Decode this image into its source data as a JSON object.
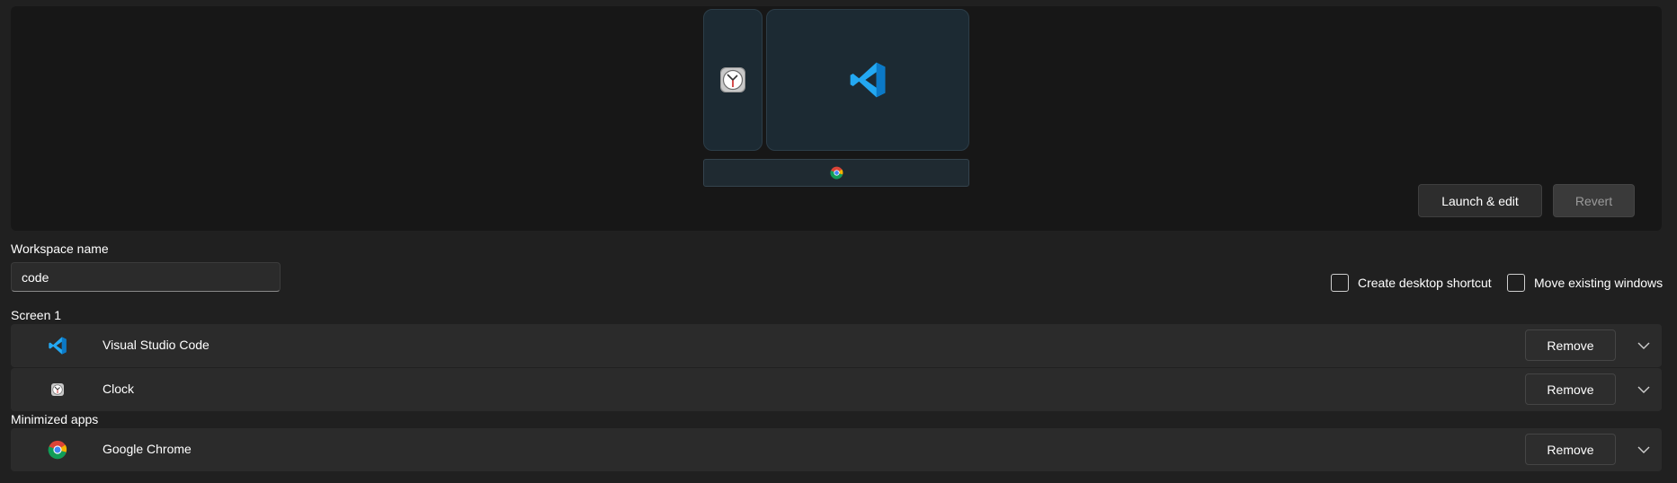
{
  "preview": {
    "launch_label": "Launch & edit",
    "revert_label": "Revert"
  },
  "workspace": {
    "name_label": "Workspace name",
    "name_value": "code",
    "create_shortcut_label": "Create desktop shortcut",
    "move_windows_label": "Move existing windows"
  },
  "screen1": {
    "heading": "Screen 1",
    "apps": [
      {
        "name": "Visual Studio Code",
        "icon": "vscode-icon",
        "remove_label": "Remove"
      },
      {
        "name": "Clock",
        "icon": "clock-icon",
        "remove_label": "Remove"
      }
    ]
  },
  "minimized": {
    "heading": "Minimized apps",
    "apps": [
      {
        "name": "Google Chrome",
        "icon": "chrome-icon",
        "remove_label": "Remove"
      }
    ]
  },
  "colors": {
    "background": "#202020",
    "preview_bg": "#171717",
    "row_bg": "#2b2b2b",
    "window_tile": "#1c2a33",
    "vscode_blue": "#23a8f2"
  }
}
